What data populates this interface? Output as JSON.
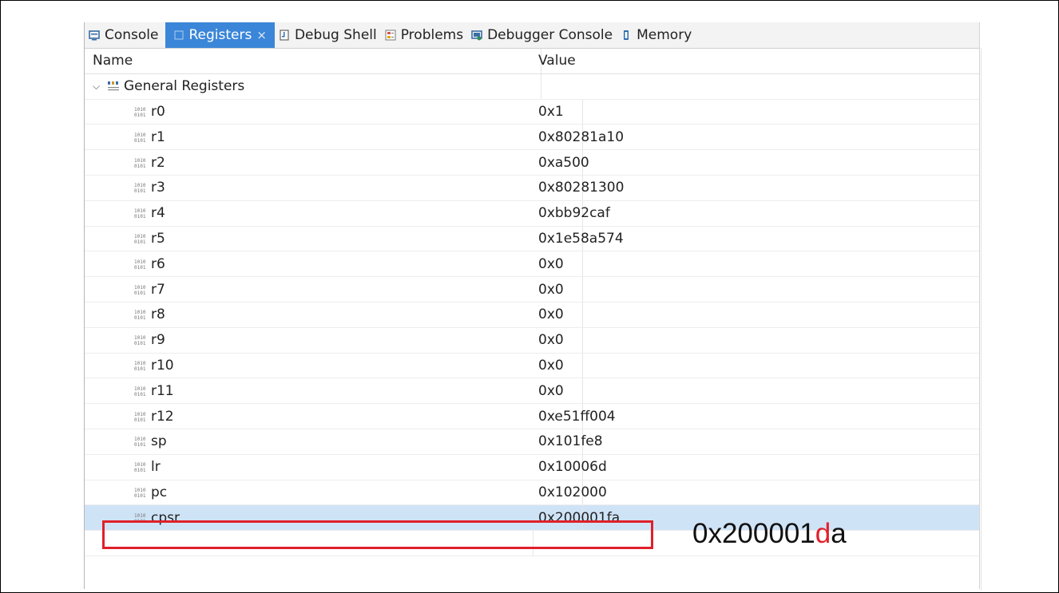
{
  "tabs": [
    {
      "label": "Console",
      "icon": "console-icon",
      "active": false
    },
    {
      "label": "Registers",
      "icon": "registers-icon",
      "active": true
    },
    {
      "label": "Debug Shell",
      "icon": "debug-shell-icon",
      "active": false
    },
    {
      "label": "Problems",
      "icon": "problems-icon",
      "active": false
    },
    {
      "label": "Debugger Console",
      "icon": "debugger-console-icon",
      "active": false
    },
    {
      "label": "Memory",
      "icon": "memory-icon",
      "active": false
    }
  ],
  "close_glyph": "×",
  "columns": {
    "name": "Name",
    "value": "Value"
  },
  "group": {
    "label": "General Registers",
    "icon": "register-group-icon",
    "expanded": true
  },
  "registers": [
    {
      "name": "r0",
      "value": "0x1"
    },
    {
      "name": "r1",
      "value": "0x80281a10"
    },
    {
      "name": "r2",
      "value": "0xa500"
    },
    {
      "name": "r3",
      "value": "0x80281300"
    },
    {
      "name": "r4",
      "value": "0xbb92caf"
    },
    {
      "name": "r5",
      "value": "0x1e58a574"
    },
    {
      "name": "r6",
      "value": "0x0"
    },
    {
      "name": "r7",
      "value": "0x0"
    },
    {
      "name": "r8",
      "value": "0x0"
    },
    {
      "name": "r9",
      "value": "0x0"
    },
    {
      "name": "r10",
      "value": "0x0"
    },
    {
      "name": "r11",
      "value": "0x0"
    },
    {
      "name": "r12",
      "value": "0xe51ff004"
    },
    {
      "name": "sp",
      "value": "0x101fe8"
    },
    {
      "name": "lr",
      "value": "0x10006d"
    },
    {
      "name": "pc",
      "value": "0x102000"
    },
    {
      "name": "cpsr",
      "value": "0x200001fa",
      "selected": true
    }
  ],
  "annotation": {
    "prefix": "0x200001",
    "highlight": "d",
    "suffix": "a",
    "highlight_color": "#e0202a"
  },
  "colors": {
    "active_tab": "#3b86d8",
    "selection": "#cfe3f7",
    "highlight_box": "#e0202a"
  }
}
